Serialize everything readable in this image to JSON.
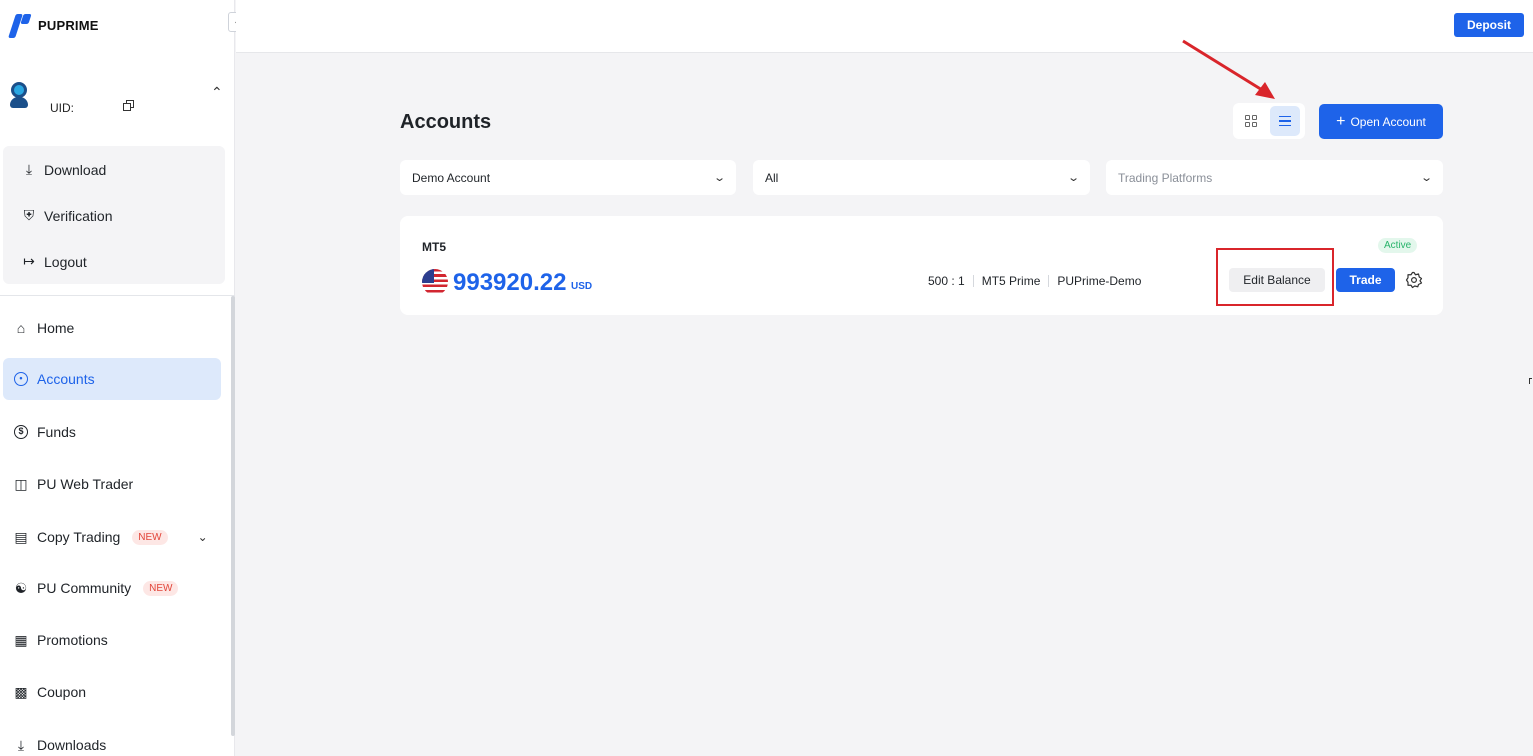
{
  "brand": {
    "name": "PUPRIME"
  },
  "user": {
    "uid_label": "UID:"
  },
  "user_menu": [
    {
      "label": "Download",
      "icon": "download-icon"
    },
    {
      "label": "Verification",
      "icon": "shield-check-icon"
    },
    {
      "label": "Logout",
      "icon": "logout-icon"
    }
  ],
  "nav": [
    {
      "label": "Home",
      "icon": "home-icon"
    },
    {
      "label": "Accounts",
      "icon": "accounts-icon",
      "active": true
    },
    {
      "label": "Funds",
      "icon": "dollar-icon"
    },
    {
      "label": "PU Web Trader",
      "icon": "candlestick-icon"
    },
    {
      "label": "Copy Trading",
      "icon": "copy-trading-icon",
      "badge": "NEW"
    },
    {
      "label": "PU Community",
      "icon": "community-icon",
      "badge": "NEW"
    },
    {
      "label": "Promotions",
      "icon": "gift-icon"
    },
    {
      "label": "Coupon",
      "icon": "coupon-icon"
    },
    {
      "label": "Downloads",
      "icon": "download-icon"
    }
  ],
  "topbar": {
    "deposit_label": "Deposit"
  },
  "main": {
    "title": "Accounts",
    "open_account_label": "Open Account",
    "filters": {
      "account_type": "Demo Account",
      "status": "All",
      "platform_placeholder": "Trading Platforms"
    },
    "account": {
      "platform": "MT5",
      "balance": "993920.22",
      "currency": "USD",
      "leverage": "500 : 1",
      "account_type": "MT5 Prime",
      "server": "PUPrime-Demo",
      "status": "Active",
      "edit_balance_label": "Edit Balance",
      "trade_label": "Trade"
    }
  },
  "colors": {
    "accent": "#1e63e9",
    "annotation": "#d9252b",
    "active_status": "#27b36a",
    "new_badge": "#e2463a"
  }
}
